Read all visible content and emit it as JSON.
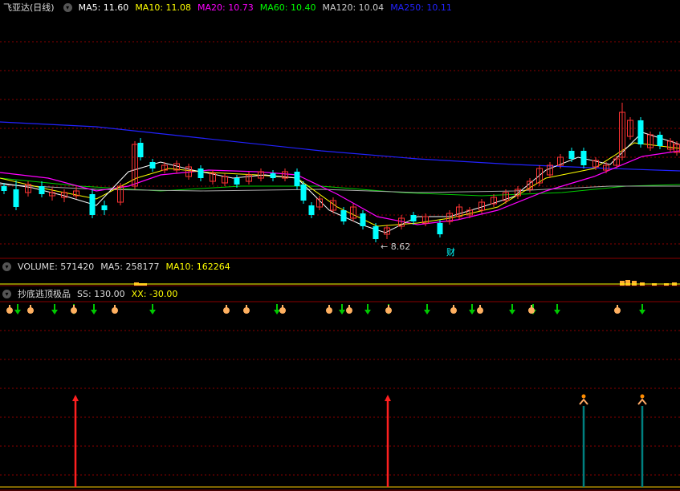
{
  "main": {
    "title": "飞亚达(日线)",
    "ma": [
      {
        "label": "MA5: 11.60",
        "color": "#ffffff"
      },
      {
        "label": "MA10: 11.08",
        "color": "#ffff00"
      },
      {
        "label": "MA20: 10.73",
        "color": "#ff00ff"
      },
      {
        "label": "MA60: 10.40",
        "color": "#00ff00"
      },
      {
        "label": "MA120: 10.04",
        "color": "#cccccc"
      },
      {
        "label": "MA250: 10.11",
        "color": "#2222ff"
      }
    ],
    "low_label": "8.62",
    "event_label": "财"
  },
  "volume": {
    "label": "VOLUME: 571420",
    "ma5": "MA5: 258177",
    "ma10": "MA10: 162264"
  },
  "indicator": {
    "name": "抄底逃顶极品",
    "ss": "SS: 130.00",
    "xx": "XX: -30.00"
  },
  "colors": {
    "up": "#ff3333",
    "down": "#00ffff",
    "grid": "#8a0000",
    "buy_arrow": "#00c800",
    "hand": "#ffb060",
    "red_signal": "#ff2020",
    "teal_signal": "#008080"
  }
}
